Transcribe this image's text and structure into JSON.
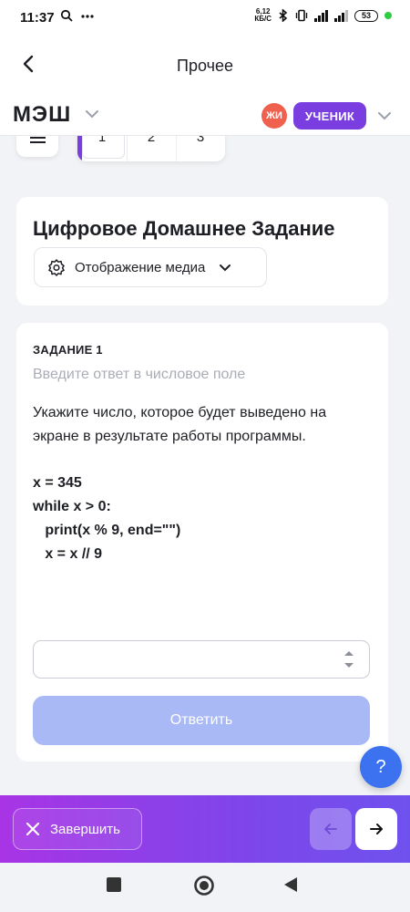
{
  "status_bar": {
    "time": "11:37",
    "net_speed_value": "6,12",
    "net_speed_unit": "КБ/С",
    "battery": "53",
    "network_type": "4G"
  },
  "header": {
    "title": "Прочее"
  },
  "brand": {
    "logo": "МЭШ",
    "avatar_initials": "ЖИ",
    "role": "УЧЕНИК"
  },
  "tabs": [
    "1",
    "2",
    "3"
  ],
  "assignment": {
    "title": "Цифровое Домашнее Задание",
    "media_button": "Отображение медиа"
  },
  "task": {
    "label": "ЗАДАНИЕ 1",
    "hint": "Введите ответ в числовое поле",
    "text": "Укажите число, которое будет выведено на экране в результате работы программы.",
    "code": [
      "x = 345",
      "while x > 0:",
      "   print(x % 9, end=\"\")",
      "   x = x // 9"
    ],
    "answer_value": "",
    "submit_label": "Ответить"
  },
  "help": {
    "label": "?"
  },
  "actions": {
    "finish_label": "Завершить"
  },
  "colors": {
    "accent": "#7a3ee0",
    "primary_disabled": "#a9b9f5",
    "help": "#3c72f0",
    "avatar": "#f0604f"
  }
}
